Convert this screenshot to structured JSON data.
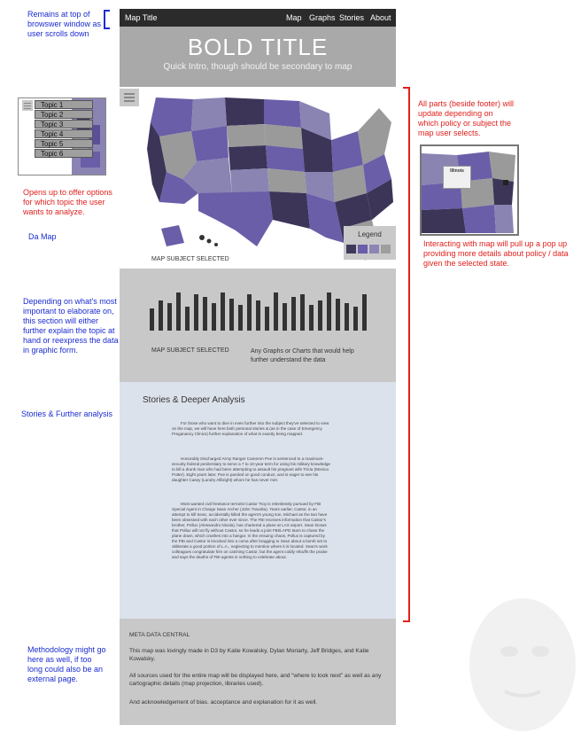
{
  "navbar": {
    "title": "Map Title",
    "links": [
      "Map",
      "Graphs",
      "Stories",
      "About"
    ]
  },
  "hero": {
    "title": "BOLD TITLE",
    "subtitle": "Quick Intro, though should be secondary to map"
  },
  "map": {
    "caption": "MAP SUBJECT SELECTED",
    "legend_label": "Legend",
    "legend_colors": [
      "#3f3a5c",
      "#6a5ea8",
      "#8c86b4",
      "#9e9e9e"
    ]
  },
  "graph": {
    "caption": "MAP SUBJECT SELECTED",
    "description": "Any Graphs or Charts that would help further understand the data",
    "bar_levels": [
      0.55,
      0.75,
      0.7,
      0.95,
      0.6,
      0.9,
      0.85,
      0.7,
      0.95,
      0.8,
      0.65,
      0.9,
      0.75,
      0.6,
      0.95,
      0.7,
      0.85,
      0.9,
      0.65,
      0.75,
      0.95,
      0.8,
      0.7,
      0.6,
      0.9
    ]
  },
  "stories": {
    "title": "Stories & Deeper Analysis",
    "paragraphs": [
      "For those who want to dive in even further into the subject they've selected to view on the map, we will have here both personal stories & (as in the case of Emergency Preganancy Clinics) further explanation of what is exactly being mapped.",
      "Honorably Discharged Army Ranger Cameron Poe is sentenced to a maximum-security federal penitentiary to serve a 7 to 10-year term for using his military knowledge to kill a drunk man who had been attempting to assault his pregnant wife Tricia (Monica Potter). Eight years later, Poe is paroled on good conduct, and is eager to see his daughter Casey (Landry Allbright) whom he has never met.",
      "Most wanted civil freelance terrorist Castor Troy is relentlessly pursued by FBI Special Agent in Charge Sean Archer (John Travolta). Years earlier, Castor, in an attempt to kill Sean, accidentally killed the agent's young son, Michael as the two have been obsessed with each other ever since. The FBI receives information that Castor's brother, Pollux (Alessandro Nivola), has chartered a plane at LAX airport. Sean knows that Pollux will not fly without Castor, so he leads a joint FBI/LAPD team to chase the plane down, which crashes into a hangar. In the ensuing chaos, Pollux is captured by the FBI and Castor is knocked into a coma after bragging to Sean about a bomb set to obliterate a good portion of L.A., neglecting to mention where it is located. Sean's work colleagues congratulate him on catching Castor, but the agent coldly rebuffs the praise and says the deaths of FBI agents is nothing to celebrate about."
    ]
  },
  "meta": {
    "title": "META DATA CENTRAL",
    "lines": [
      "This map was lovingly made in D3 by Katie Kowalsky, Dylan Moriarty, Jeff Bridges, and Katie Kowalsky.",
      "All sources used for the entire map will be displayed here, and “where to look next” as well as any cartographic details (map projection, libraries used).",
      "And acknowledgement of bias. acceptance and explanation for it as well."
    ]
  },
  "topics": [
    "Topic 1",
    "Topic 2",
    "Topic 3",
    "Topic 4",
    "Topic 5",
    "Topic 6"
  ],
  "annotations": {
    "top_left": "Remains at top of browswer window as user scrolls down",
    "topic_note": "Opens up to offer options for which topic the user wants to analyze.",
    "da_map": "Da Map",
    "graph_note": "Depending on what's most important to elaborate on, this section will either further explain the topic at hand or reexpress the data in graphic form.",
    "stories_note": "Stories & Further analysis",
    "method_note": "Methodology might go here as well, if too long could also be an external page.",
    "update_note": "All parts (beside footer) will update depending on which policy or subject the map user selects.",
    "popup_note": "Interacting with map will pull up a pop up providing more details about policy / data given the selected state."
  },
  "popup_thumb": {
    "title": "Illinois"
  }
}
